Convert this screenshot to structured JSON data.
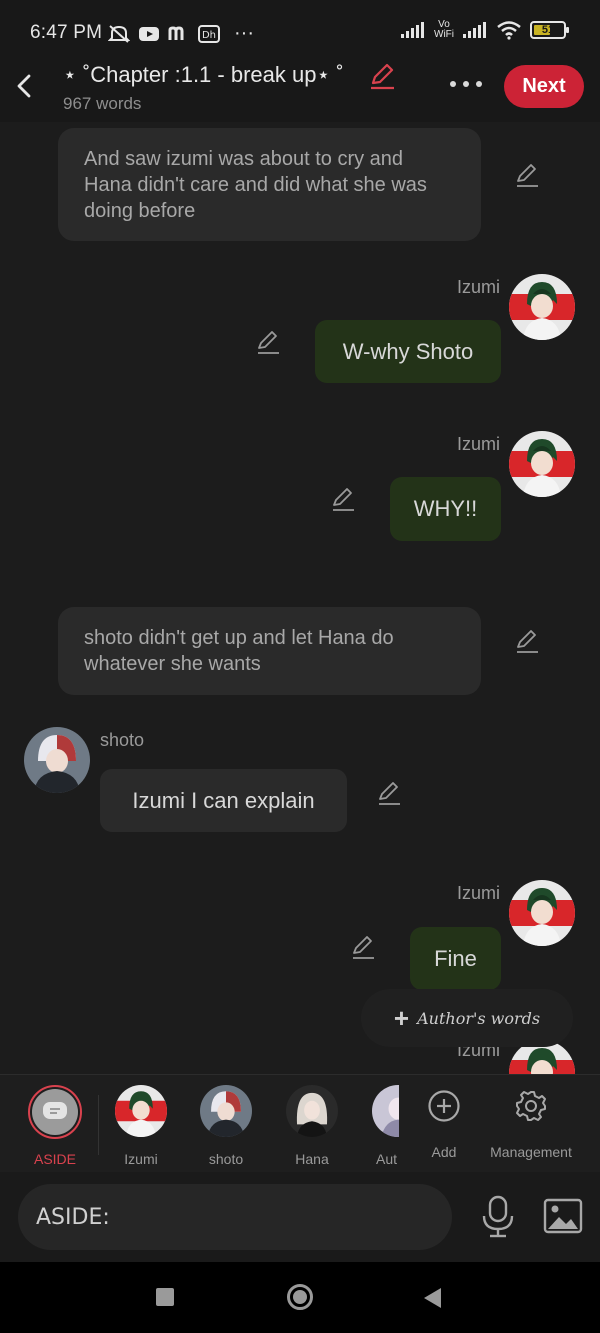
{
  "status_bar": {
    "time": "6:47 PM",
    "left_icons": [
      "mute-icon",
      "youtube-icon",
      "m-app-icon",
      "dh-app-icon",
      "more-dots-icon"
    ],
    "more": "···",
    "vowifi_top": "Vo",
    "vowifi_bottom": "WiFi",
    "battery_level": "51",
    "battery_color": "#c8b324"
  },
  "header": {
    "title": "⋆ ˚Chapter :1.1 - break up⋆ ˚",
    "word_count": "967 words",
    "next_label": "Next",
    "accent": "#cc2336"
  },
  "messages": {
    "narration1": "And saw izumi was about to cry and Hana didn't care and did what she was doing before",
    "m1_name": "Izumi",
    "m1_text": "W-why Shoto",
    "m2_name": "Izumi",
    "m2_text": "WHY!!",
    "narration2": "shoto didn't get up and let Hana do whatever she wants",
    "m3_name": "shoto",
    "m3_text": "Izumi I can explain",
    "m4_name": "Izumi",
    "m4_text": "Fine",
    "m5_name": "Izumi",
    "bubble_color": "#233318"
  },
  "authors_words_label": "Author's words",
  "character_bar": {
    "items": [
      {
        "label": "ASIDE"
      },
      {
        "label": "Izumi"
      },
      {
        "label": "shoto"
      },
      {
        "label": "Hana"
      },
      {
        "label": "Aut"
      }
    ],
    "add_label": "Add",
    "management_label": "Management",
    "active_color": "#d9424e"
  },
  "input_bar": {
    "placeholder": "ASIDE:"
  }
}
